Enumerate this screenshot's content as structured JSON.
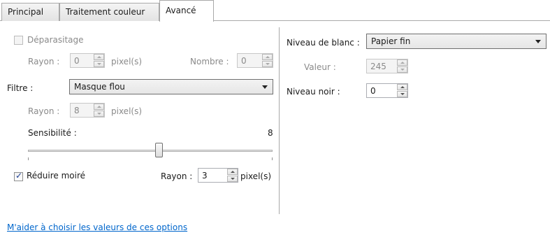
{
  "tabs": [
    {
      "label": "Principal"
    },
    {
      "label": "Traitement couleur"
    },
    {
      "label": "Avancé",
      "active": true
    }
  ],
  "left": {
    "deparasitage": {
      "label": "Déparasitage",
      "checked": false,
      "disabled": true
    },
    "rayon1": {
      "label": "Rayon :",
      "value": "0",
      "unit": "pixel(s)"
    },
    "nombre": {
      "label": "Nombre :",
      "value": "0"
    },
    "filtre": {
      "label": "Filtre :",
      "value": "Masque flou"
    },
    "rayon2": {
      "label": "Rayon :",
      "value": "8",
      "unit": "pixel(s)"
    },
    "sensibilite": {
      "label": "Sensibilité :",
      "value": "8"
    },
    "reduire_moire": {
      "label": "Réduire moiré",
      "checked": true
    },
    "rayon3": {
      "label": "Rayon :",
      "value": "3",
      "unit": "pixel(s)"
    }
  },
  "right": {
    "niveau_blanc": {
      "label": "Niveau de blanc :",
      "value": "Papier fin"
    },
    "valeur": {
      "label": "Valeur :",
      "value": "245"
    },
    "niveau_noir": {
      "label": "Niveau noir :",
      "value": "0"
    }
  },
  "help_link": "M'aider à choisir les valeurs de ces options",
  "colors": {
    "link": "#0066cc",
    "border": "#a9a9a9",
    "disabled_text": "#8a8a8a"
  }
}
